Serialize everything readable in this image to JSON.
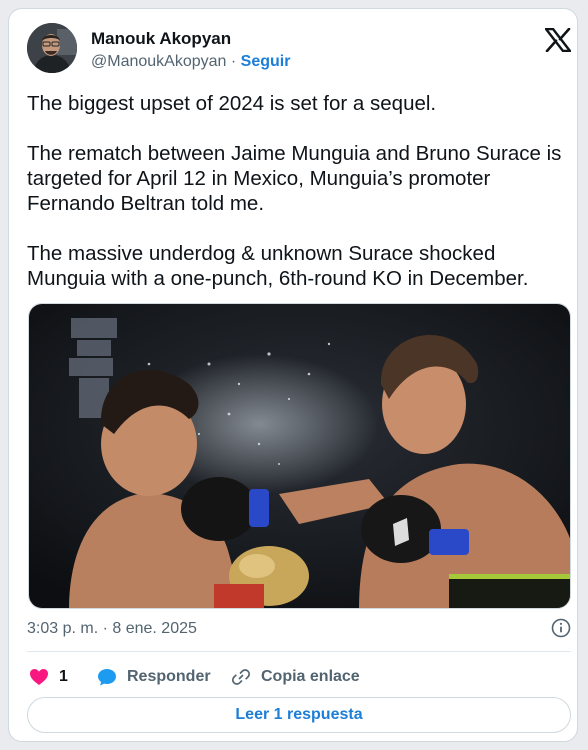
{
  "author": {
    "name": "Manouk Akopyan",
    "handle": "@ManoukAkopyan",
    "separator": " · ",
    "follow_label": "Seguir"
  },
  "tweet": {
    "paragraphs": [
      "The biggest upset of 2024 is set for a sequel.",
      "The rematch between Jaime Munguia and Bruno Surace is targeted for April 12 in Mexico, Munguia’s promoter Fernando Beltran told me.",
      "The massive underdog & unknown Surace shocked Munguia with a one-punch, 6th-round KO in December."
    ],
    "timestamp": "3:03 p. m. · 8 ene. 2025"
  },
  "actions": {
    "like_count": "1",
    "reply_label": "Responder",
    "copy_label": "Copia enlace",
    "read_replies_label": "Leer 1 respuesta"
  },
  "icons": {
    "platform": "x-logo-icon",
    "like": "heart-icon",
    "reply": "speech-bubble-icon",
    "copy": "link-icon",
    "info": "info-icon"
  },
  "colors": {
    "accent": "#1d7ed8",
    "like": "#f91880",
    "reply": "#1d9bf0",
    "text": "#0f1419",
    "muted": "#536471"
  }
}
